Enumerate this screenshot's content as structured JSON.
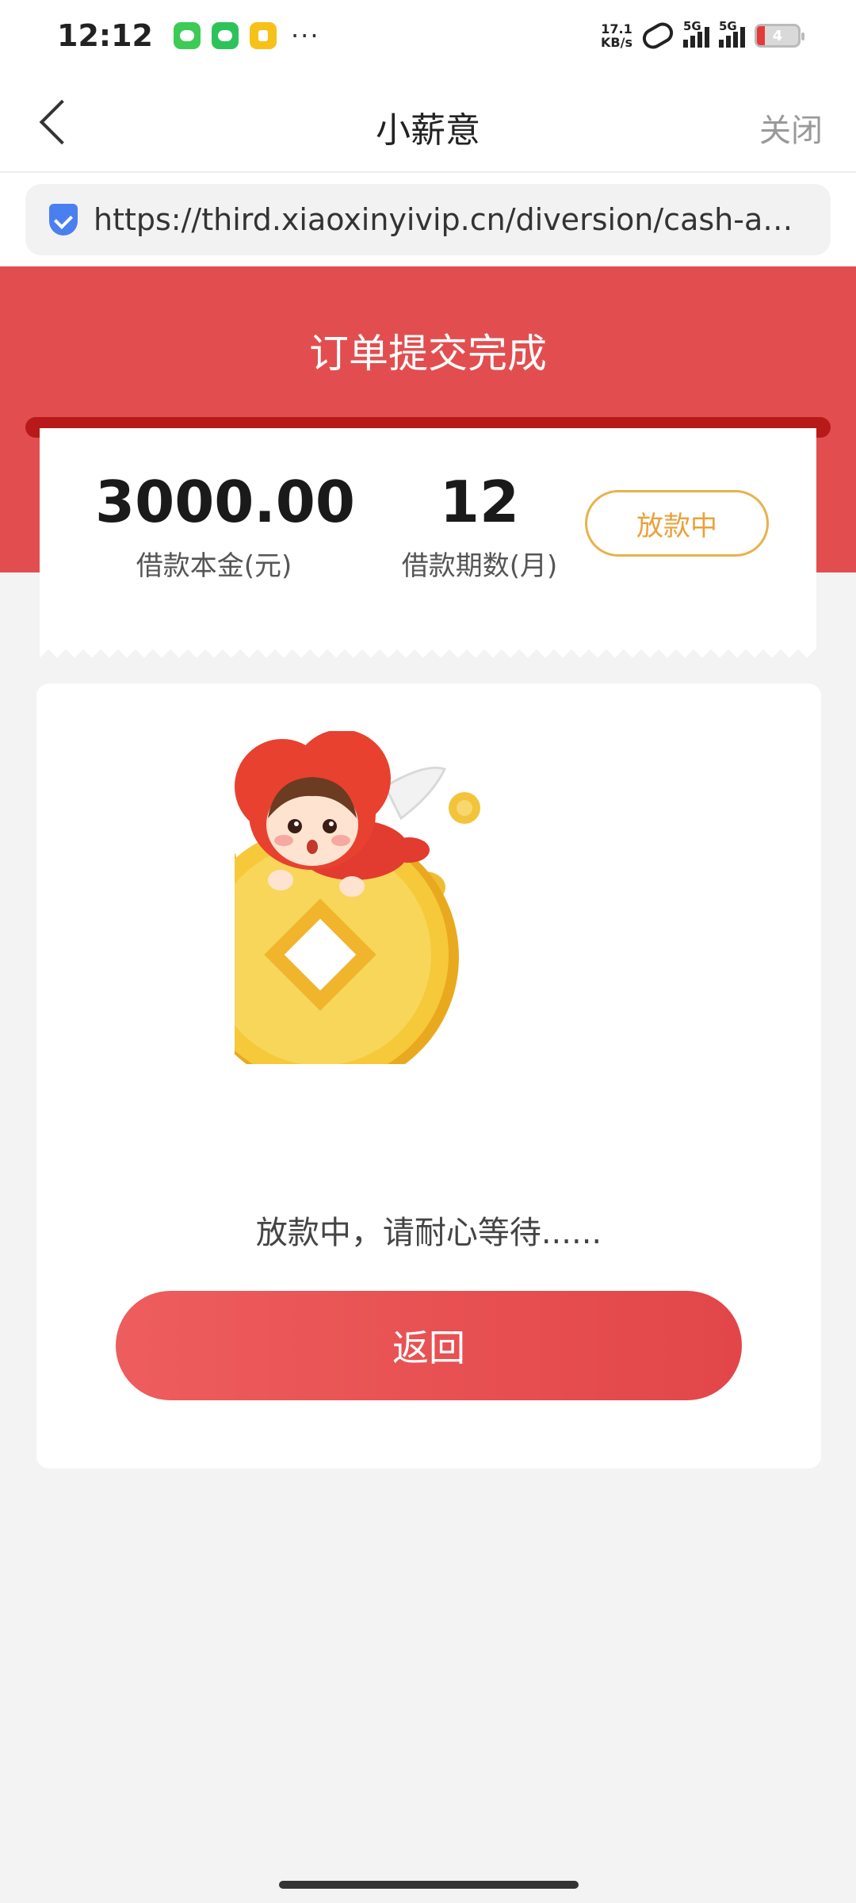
{
  "status_bar": {
    "time": "12:12",
    "net_speed_value": "17.1",
    "net_speed_unit": "KB/s",
    "signal1_label": "5G",
    "signal2_label": "5G",
    "battery_level": "4",
    "more": "···"
  },
  "nav": {
    "title": "小薪意",
    "close_label": "关闭"
  },
  "url_bar": {
    "url": "https://third.xiaoxinyivip.cn/diversion/cash-apply?c..."
  },
  "header": {
    "title": "订单提交完成"
  },
  "loan": {
    "amount": "3000.00",
    "amount_label": "借款本金(元)",
    "term": "12",
    "term_label": "借款期数(月)",
    "status": "放款中"
  },
  "main": {
    "wait_message": "放款中，请耐心等待......",
    "return_label": "返回"
  },
  "colors": {
    "brand_red": "#e24e4f",
    "pill_gold": "#e8b24a"
  }
}
